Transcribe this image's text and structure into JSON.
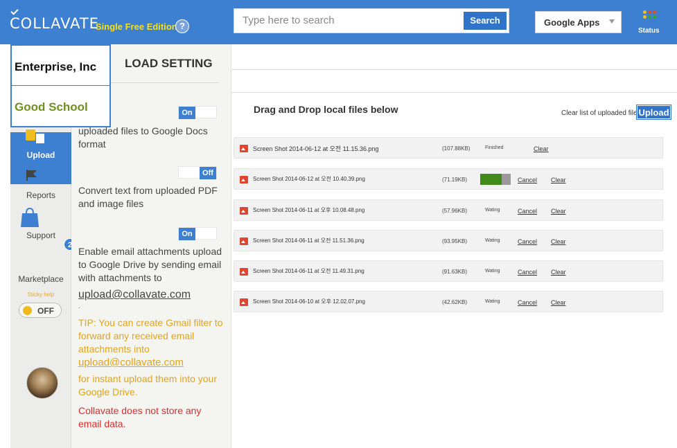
{
  "header": {
    "logo": "COLLAVATE",
    "edition": "Single Free Edition",
    "help": "?",
    "search_placeholder": "Type here to search",
    "search_button": "Search",
    "apps_select": "Google Apps",
    "status_label": "Status",
    "status_colors": [
      "#f0c020",
      "#e84a2e",
      "#e84a2e",
      "#f0c020",
      "#3aa63a",
      "#3aa63a"
    ]
  },
  "orgs": [
    "Enterprise, Inc",
    "Good School"
  ],
  "nav": {
    "upload": "Upload",
    "reports": "Reports",
    "support": "Support",
    "marketplace": "Marketplace",
    "badge": "2",
    "sticky_help": "Sticky help",
    "sticky_toggle": "OFF"
  },
  "settings": {
    "title": "LOAD SETTING",
    "toggle1": "On",
    "text1": "uploaded files to Google Docs format",
    "toggle2": "Off",
    "text2": "Convert text from uploaded PDF and image files",
    "toggle3": "On",
    "text3": "Enable email attachments upload to Google Drive by sending email with attachments to",
    "email": "upload@collavate.com",
    "dot": ".",
    "tip": "TIP: You can create Gmail filter to forward any received email attachments into",
    "tip_email": "upload@collavate.com",
    "tip_tail": "for instant upload them into your Google Drive.",
    "no_data": "Collavate does not store any email data."
  },
  "main": {
    "dnd_title": "Drag and Drop local files below",
    "clear_list": "Clear list of uploaded files",
    "upload_button": "Upload",
    "cancel": "Cancel",
    "clear": "Clear",
    "progress_fraction": 0.7,
    "files": [
      {
        "name": "Screen Shot 2014-06-12 at 오전 11.15.36.png",
        "size": "(107.88KB)",
        "status": "Finished"
      },
      {
        "name": "Screen Shot 2014-06-12 at 오전 10.40.39.png",
        "size": "(71.19KB)",
        "status": ""
      },
      {
        "name": "Screen Shot 2014-06-11 at 오후 10.08.48.png",
        "size": "(57.96KB)",
        "status": "Wating"
      },
      {
        "name": "Screen Shot 2014-06-11 at 오전 11.51.36.png",
        "size": "(93.95KB)",
        "status": "Wating"
      },
      {
        "name": "Screen Shot 2014-06-11 at 오전 11.49.31.png",
        "size": "(91.63KB)",
        "status": "Wating"
      },
      {
        "name": "Screen Shot 2014-06-10 at 오후 12.02.07.png",
        "size": "(42.62KB)",
        "status": "Wating"
      }
    ]
  }
}
